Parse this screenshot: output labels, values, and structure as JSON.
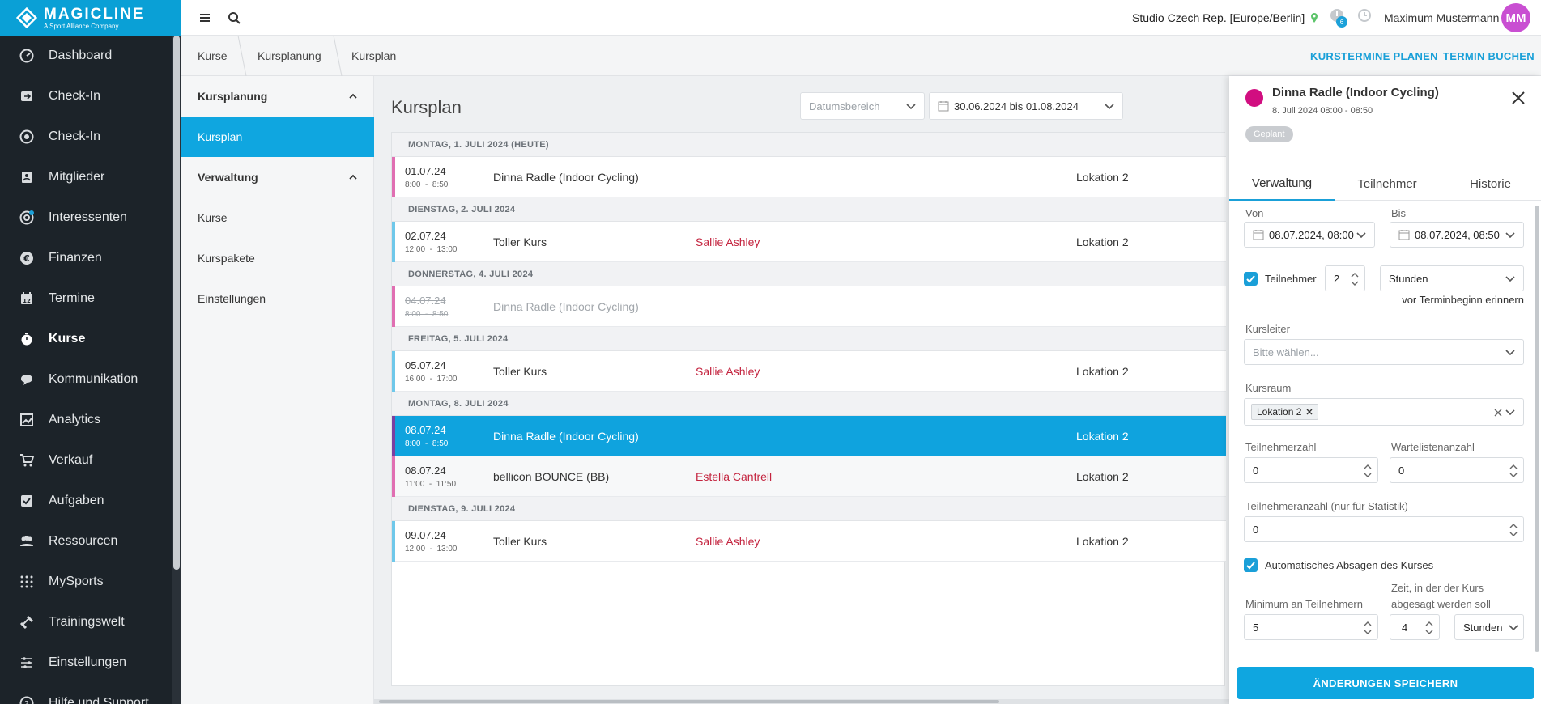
{
  "brand": {
    "name": "MAGICLINE",
    "tagline": "A Sport Alliance Company",
    "color": "#0aa0d6"
  },
  "nav": {
    "items": [
      {
        "label": "Dashboard",
        "icon": "dashboard-icon"
      },
      {
        "label": "Check-In",
        "icon": "checkin-icon"
      },
      {
        "label": "Check-In",
        "icon": "checkin-target-icon"
      },
      {
        "label": "Mitglieder",
        "icon": "members-icon"
      },
      {
        "label": "Interessenten",
        "icon": "prospects-icon"
      },
      {
        "label": "Finanzen",
        "icon": "finance-icon"
      },
      {
        "label": "Termine",
        "icon": "calendar-icon"
      },
      {
        "label": "Kurse",
        "icon": "courses-icon"
      },
      {
        "label": "Kommunikation",
        "icon": "chat-icon"
      },
      {
        "label": "Analytics",
        "icon": "analytics-icon"
      },
      {
        "label": "Verkauf",
        "icon": "cart-icon"
      },
      {
        "label": "Aufgaben",
        "icon": "tasks-icon"
      },
      {
        "label": "Ressourcen",
        "icon": "resources-icon"
      },
      {
        "label": "MySports",
        "icon": "mysports-icon"
      },
      {
        "label": "Trainingswelt",
        "icon": "dumbbell-icon"
      },
      {
        "label": "Einstellungen",
        "icon": "settings-icon"
      },
      {
        "label": "Hilfe und Support",
        "icon": "help-icon"
      }
    ],
    "active": "Kurse"
  },
  "topbar": {
    "studio": "Studio Czech Rep. [Europe/Berlin]",
    "notification_count": "6",
    "user_name": "Maximum Mustermann",
    "user_initials": "MM"
  },
  "breadcrumb": [
    "Kurse",
    "Kursplanung",
    "Kursplan"
  ],
  "actions": {
    "plan": "KURSTERMINE PLANEN",
    "book": "TERMIN BUCHEN"
  },
  "subnav": {
    "group1": "Kursplanung",
    "group1_items": [
      "Kursplan"
    ],
    "group2": "Verwaltung",
    "group2_items": [
      "Kurse",
      "Kurspakete",
      "Einstellungen"
    ]
  },
  "main": {
    "title": "Kursplan",
    "date_range_placeholder": "Datumsbereich",
    "date_range": "30.06.2024 bis 01.08.2024"
  },
  "schedule": {
    "days": [
      {
        "header": "MONTAG, 1. JULI 2024 (HEUTE)",
        "rows": [
          {
            "date": "01.07.24",
            "time": "8:00  -  8:50",
            "name": "Dinna Radle (Indoor Cycling)",
            "trainer": "",
            "location": "Lokation 2",
            "color": "#e06fb2",
            "state": "normal"
          }
        ]
      },
      {
        "header": "DIENSTAG, 2. JULI 2024",
        "rows": [
          {
            "date": "02.07.24",
            "time": "12:00  -  13:00",
            "name": "Toller Kurs",
            "trainer": "Sallie Ashley",
            "location": "Lokation 2",
            "color": "#6fc8ea",
            "state": "normal"
          }
        ]
      },
      {
        "header": "DONNERSTAG, 4. JULI 2024",
        "rows": [
          {
            "date": "04.07.24",
            "time": "8:00  -  8:50",
            "name": "Dinna Radle (Indoor Cycling)",
            "trainer": "",
            "location": "",
            "color": "#e06fb2",
            "state": "cancelled"
          }
        ]
      },
      {
        "header": "FREITAG, 5. JULI 2024",
        "rows": [
          {
            "date": "05.07.24",
            "time": "16:00  -  17:00",
            "name": "Toller Kurs",
            "trainer": "Sallie Ashley",
            "location": "Lokation 2",
            "color": "#6fc8ea",
            "state": "normal"
          }
        ]
      },
      {
        "header": "MONTAG, 8. JULI 2024",
        "rows": [
          {
            "date": "08.07.24",
            "time": "8:00  -  8:50",
            "name": "Dinna Radle (Indoor Cycling)",
            "trainer": "",
            "location": "Lokation 2",
            "color": "#7b3fa0",
            "state": "selected"
          },
          {
            "date": "08.07.24",
            "time": "11:00  -  11:50",
            "name": "bellicon BOUNCE (BB)",
            "trainer": "Estella Cantrell",
            "location": "Lokation 2",
            "color": "#e06fb2",
            "state": "grey"
          }
        ]
      },
      {
        "header": "DIENSTAG, 9. JULI 2024",
        "rows": [
          {
            "date": "09.07.24",
            "time": "12:00  -  13:00",
            "name": "Toller Kurs",
            "trainer": "Sallie Ashley",
            "location": "Lokation 2",
            "color": "#6fc8ea",
            "state": "normal"
          }
        ]
      }
    ]
  },
  "panel": {
    "title": "Dinna Radle (Indoor Cycling)",
    "subtitle": "8. Juli 2024 08:00 - 08:50",
    "status": "Geplant",
    "course_color": "#d10e80",
    "tabs": [
      "Verwaltung",
      "Teilnehmer",
      "Historie"
    ],
    "von_label": "Von",
    "von": "08.07.2024, 08:00",
    "bis_label": "Bis",
    "bis": "08.07.2024, 08:50",
    "teilnehmer_label": "Teilnehmer",
    "reminder_value": "2",
    "reminder_unit": "Stunden",
    "reminder_text": "vor Terminbeginn erinnern",
    "kursleiter_label": "Kursleiter",
    "kursleiter_placeholder": "Bitte wählen...",
    "kursraum_label": "Kursraum",
    "kursraum_tag": "Lokation 2",
    "teilnehmerzahl_label": "Teilnehmerzahl",
    "teilnehmerzahl": "0",
    "warteliste_label": "Wartelistenanzahl",
    "warteliste": "0",
    "statistik_label": "Teilnehmeranzahl (nur für Statistik)",
    "statistik": "0",
    "auto_cancel_label": "Automatisches Absagen des Kurses",
    "minimum_label": "Minimum an Teilnehmern",
    "minimum": "5",
    "cancel_time_label_1": "Zeit, in der der Kurs",
    "cancel_time_label_2": "abgesagt werden soll",
    "cancel_time": "4",
    "cancel_unit": "Stunden",
    "save": "ÄNDERUNGEN SPEICHERN"
  }
}
